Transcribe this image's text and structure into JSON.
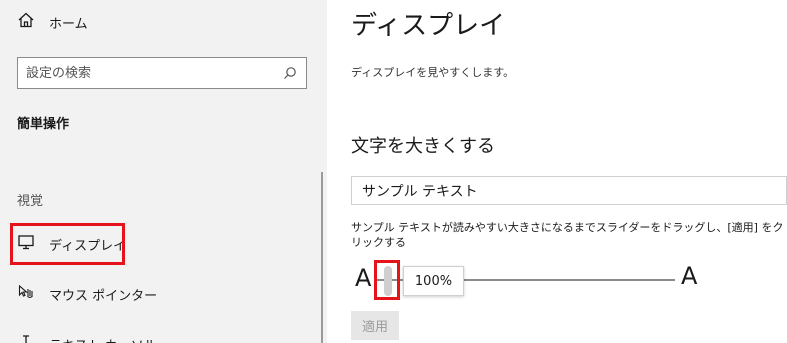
{
  "colors": {
    "sidebar_bg": "#f2f2f2",
    "highlight": "#e5141a",
    "disabled_text": "#9a9a9a"
  },
  "sidebar": {
    "home": {
      "icon": "home-icon",
      "label": "ホーム"
    },
    "search": {
      "placeholder": "設定の検索",
      "icon": "search-icon"
    },
    "section_heading": "簡単操作",
    "group_label": "視覚",
    "items": [
      {
        "icon": "monitor-icon",
        "label": "ディスプレイ",
        "selected": true
      },
      {
        "icon": "mouse-pointer-icon",
        "label": "マウス ポインター"
      },
      {
        "icon": "text-cursor-icon",
        "label": "テキスト カーソル"
      }
    ]
  },
  "main": {
    "title": "ディスプレイ",
    "description": "ディスプレイを見やすくします。",
    "section_title": "文字を大きくする",
    "sample_text": "サンプル テキスト",
    "instructions": "サンプル テキストが読みやすい大きさになるまでスライダーをドラッグし、[適用] をクリックする",
    "slider": {
      "min_label": "A",
      "max_label": "A",
      "value_label": "100%",
      "value": 0.0
    },
    "apply_label": "適用"
  }
}
